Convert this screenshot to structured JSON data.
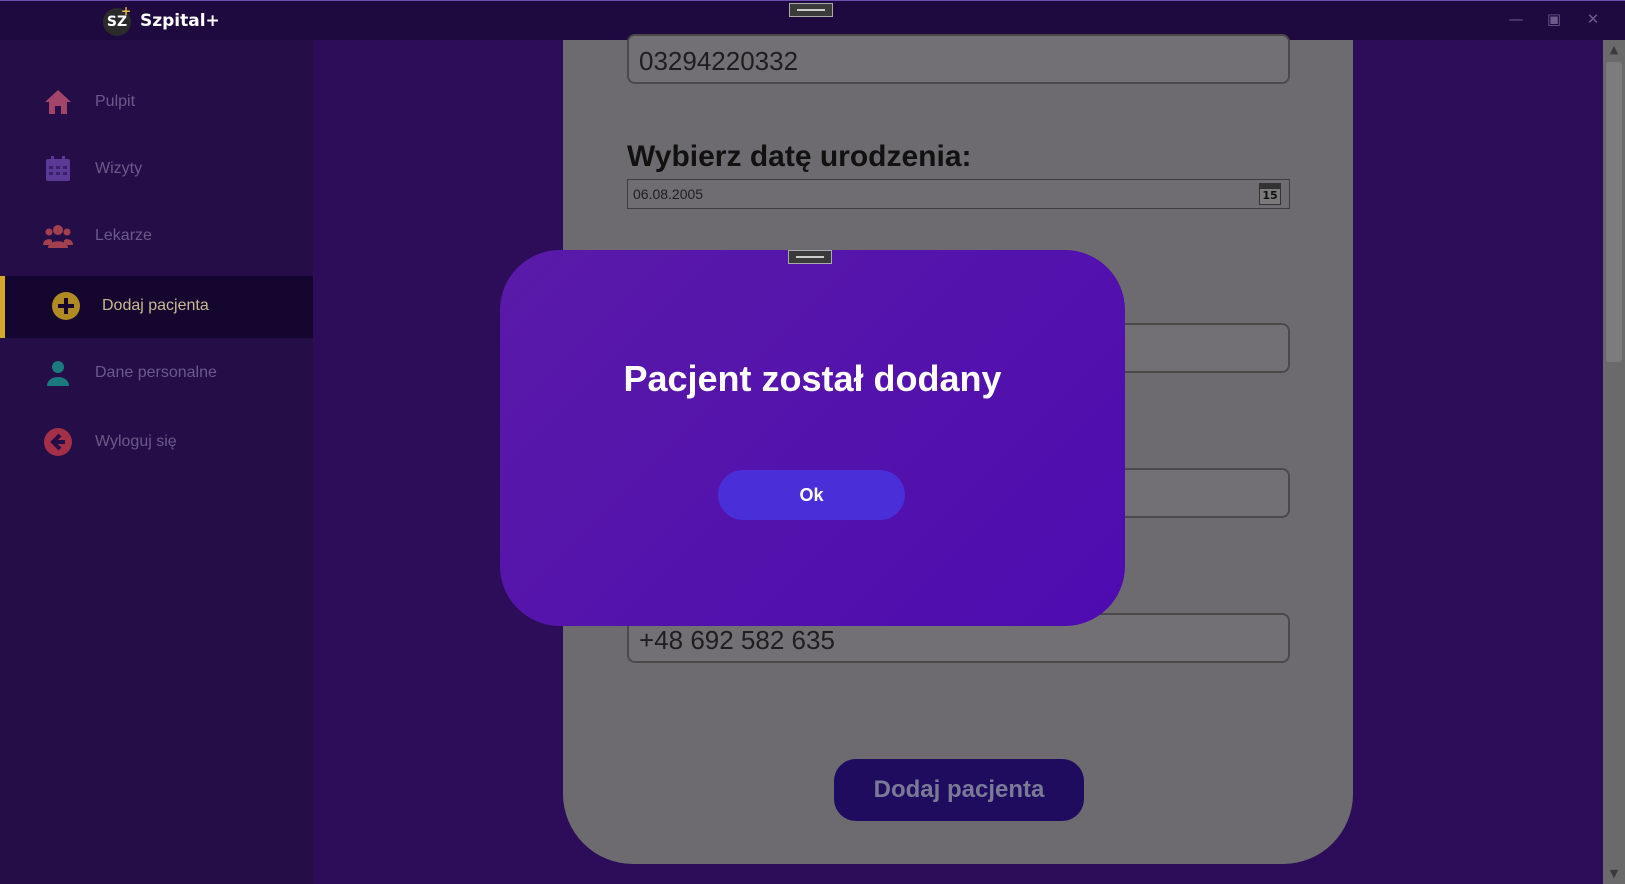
{
  "app": {
    "title": "Szpital+",
    "logo_text": "SZ",
    "logo_plus": "+"
  },
  "window_controls": {
    "minimize": "—",
    "maximize": "▣",
    "close": "✕"
  },
  "sidebar": {
    "items": [
      {
        "label": "Pulpit",
        "icon": "home-icon",
        "color": "#e05a8a"
      },
      {
        "label": "Wizyty",
        "icon": "calendar-icon",
        "color": "#7a4fc9"
      },
      {
        "label": "Lekarze",
        "icon": "users-icon",
        "color": "#d04a5a"
      },
      {
        "label": "Dodaj pacjenta",
        "icon": "plus-circle-icon",
        "color": "#d4a82a",
        "active": true
      },
      {
        "label": "Dane personalne",
        "icon": "user-icon",
        "color": "#1aa6a6"
      },
      {
        "label": "Wyloguj się",
        "icon": "arrow-left-circle-icon",
        "color": "#d03a5a"
      }
    ]
  },
  "form": {
    "pesel_value": "03294220332",
    "birthdate_label": "Wybierz datę urodzenia:",
    "birthdate_value": "06.08.2005",
    "calendar_day": "15",
    "phone_value": "+48 692 582 635",
    "submit_label": "Dodaj pacjenta"
  },
  "dialog": {
    "title": "Pacjent został dodany",
    "ok_label": "Ok"
  },
  "scrollbar": {
    "up": "▲",
    "down": "▼"
  }
}
